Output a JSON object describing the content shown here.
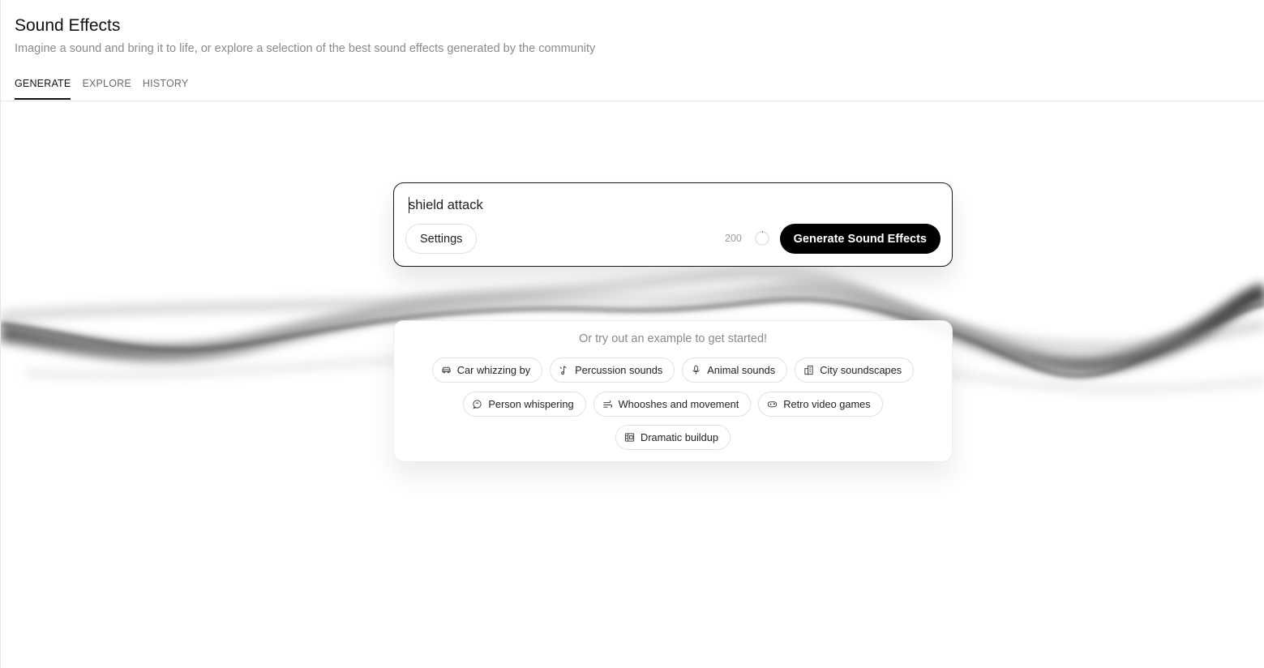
{
  "header": {
    "title": "Sound Effects",
    "subtitle": "Imagine a sound and bring it to life, or explore a selection of the best sound effects generated by the community"
  },
  "tabs": [
    {
      "label": "GENERATE",
      "active": true
    },
    {
      "label": "EXPLORE",
      "active": false
    },
    {
      "label": "HISTORY",
      "active": false
    }
  ],
  "prompt": {
    "value": "shield attack",
    "char_count": "200",
    "settings_label": "Settings",
    "generate_label": "Generate Sound Effects"
  },
  "examples": {
    "heading": "Or try out an example to get started!",
    "chips": [
      {
        "label": "Car whizzing by",
        "icon": "car-icon"
      },
      {
        "label": "Percussion sounds",
        "icon": "music-note-icon"
      },
      {
        "label": "Animal sounds",
        "icon": "microphone-icon"
      },
      {
        "label": "City soundscapes",
        "icon": "building-icon"
      },
      {
        "label": "Person whispering",
        "icon": "speech-bubble-icon"
      },
      {
        "label": "Whooshes and movement",
        "icon": "wind-icon"
      },
      {
        "label": "Retro video games",
        "icon": "gamepad-icon"
      },
      {
        "label": "Dramatic buildup",
        "icon": "film-icon"
      }
    ]
  },
  "colors": {
    "accent": "#000000",
    "muted_text": "#8a8a8a",
    "border": "#e1e1e1"
  }
}
